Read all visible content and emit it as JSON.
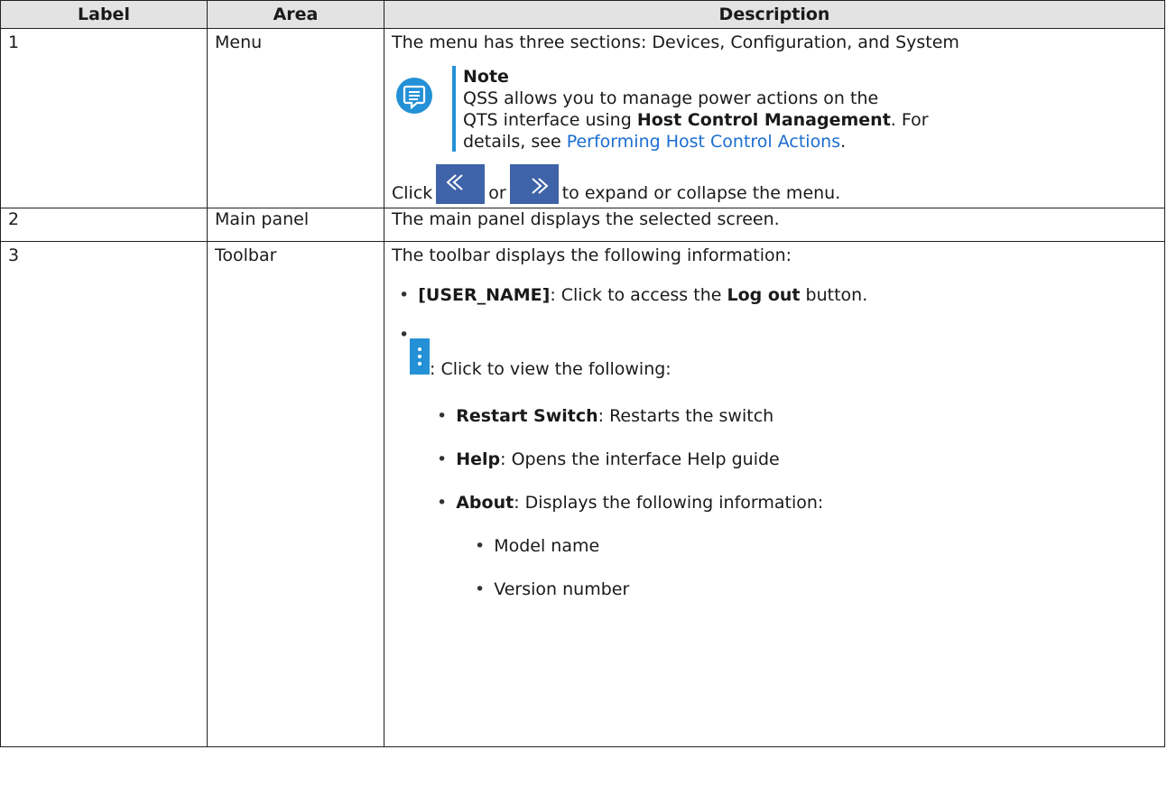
{
  "table": {
    "headers": [
      "Label",
      "Area",
      "Description"
    ],
    "rows": [
      {
        "label": "1",
        "area": "Menu",
        "intro": "The menu has three sections: Devices, Configuration, and System",
        "note": {
          "title": "Note",
          "line1": "QSS allows you to manage power actions on the",
          "line2_pre": "QTS interface using ",
          "line2_bold": "Host Control Management",
          "line2_post": ". For",
          "line3_pre": "details, see ",
          "line3_link": "Performing Host Control Actions",
          "line3_post": "."
        },
        "click_word": "Click",
        "or_word": "or",
        "click_tail": "to expand or collapse the menu."
      },
      {
        "label": "2",
        "area": "Main panel",
        "description": "The main panel displays the selected screen."
      },
      {
        "label": "3",
        "area": "Toolbar",
        "intro": "The toolbar displays the following information:",
        "user_bold": "[USER_NAME]",
        "user_mid": ": Click to access the ",
        "user_bold2": "Log out",
        "user_tail": " button.",
        "kebab_text": ": Click to view the following:",
        "sub": [
          {
            "bold": "Restart Switch",
            "text": ": Restarts the switch"
          },
          {
            "bold": "Help",
            "text": ": Opens the interface Help guide"
          },
          {
            "bold": "About",
            "text": ": Displays the following information:"
          }
        ],
        "about_items": [
          "Model name",
          "Version number"
        ]
      }
    ]
  },
  "colors": {
    "note_accent": "#2491d6",
    "link": "#1a6dd0",
    "arrow_button": "#3f63a8",
    "header_bg": "#e3e3e3"
  },
  "icons": {
    "note": "note-icon",
    "collapse": "double-chevron-left-icon",
    "expand": "double-chevron-right-icon",
    "kebab": "kebab-menu-icon"
  }
}
